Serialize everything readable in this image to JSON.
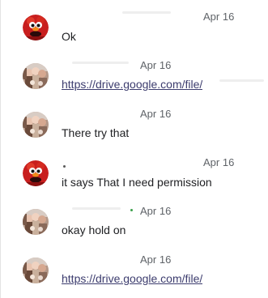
{
  "messages": [
    {
      "sender_avatar": "red-monster-avatar",
      "date": "Apr 16",
      "text": "Ok",
      "is_link": false
    },
    {
      "sender_avatar": "group-photo-avatar",
      "date": "Apr 16",
      "text": "https://drive.google.com/file/",
      "is_link": true
    },
    {
      "sender_avatar": "group-photo-avatar",
      "date": "Apr 16",
      "text": "There try that",
      "is_link": false
    },
    {
      "sender_avatar": "red-monster-avatar",
      "date": "Apr 16",
      "text": "it says That I need permission",
      "is_link": false
    },
    {
      "sender_avatar": "group-photo-avatar",
      "date": "Apr 16",
      "text": "okay hold on",
      "is_link": false
    },
    {
      "sender_avatar": "group-photo-avatar",
      "date": "Apr 16",
      "text": "https://drive.google.com/file/",
      "is_link": true
    }
  ],
  "colors": {
    "link": "#3c3c6e",
    "date": "#5f6368",
    "text": "#202124"
  }
}
